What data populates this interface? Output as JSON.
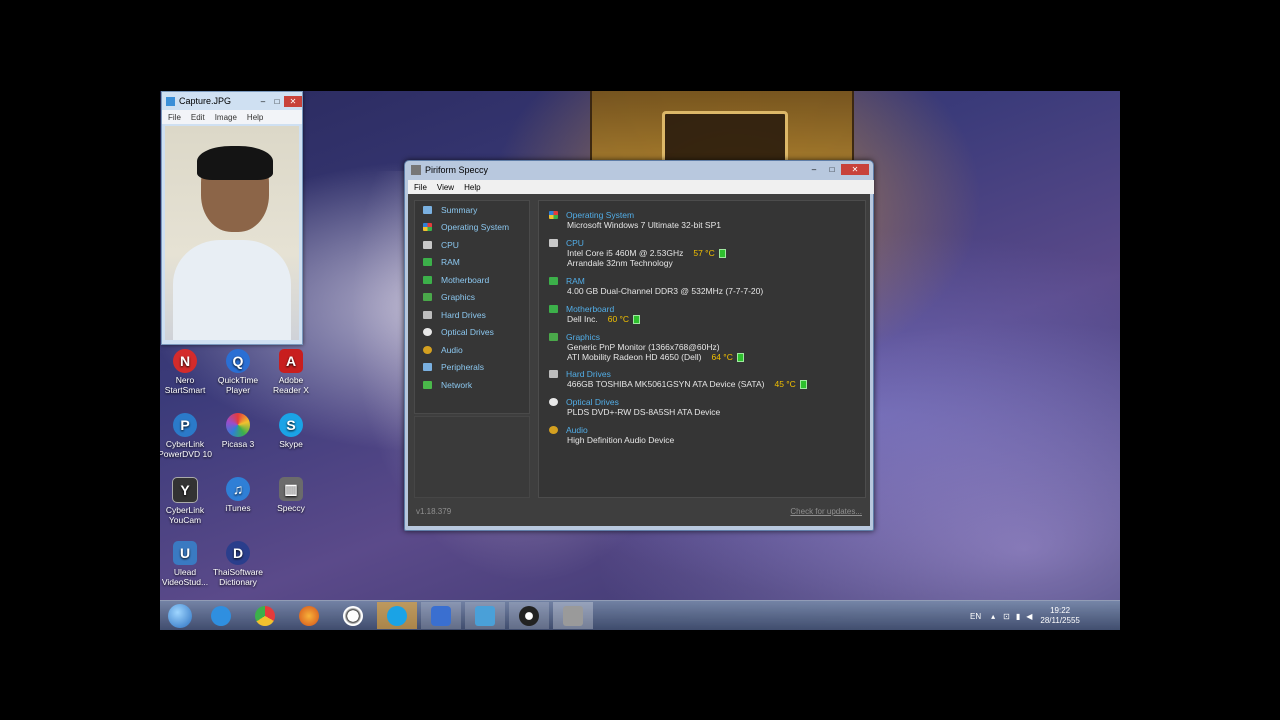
{
  "colors": {
    "accent_text": "#52aee8",
    "temp": "#f2c000",
    "sidebar_text": "#8cc8f0",
    "panel_bg": "#353535"
  },
  "capture_window": {
    "title": "Capture.JPG",
    "menu": [
      "File",
      "Edit",
      "Image",
      "Help"
    ]
  },
  "desktop_icons": [
    {
      "name": "Nero StartSmart",
      "line1": "Nero",
      "line2": "StartSmart",
      "icon": "nero-icon",
      "color": "#d42b2b"
    },
    {
      "name": "QuickTime Player",
      "line1": "QuickTime",
      "line2": "Player",
      "icon": "quicktime-icon",
      "color": "#2a6fd4"
    },
    {
      "name": "Adobe Reader X",
      "line1": "Adobe",
      "line2": "Reader X",
      "icon": "adobe-reader-icon",
      "color": "#c81e1e"
    },
    {
      "name": "CyberLink PowerDVD 10",
      "line1": "CyberLink",
      "line2": "PowerDVD 10",
      "icon": "powerdvd-icon",
      "color": "#2b7ac9"
    },
    {
      "name": "Picasa 3",
      "line1": "Picasa 3",
      "line2": "",
      "icon": "picasa-icon",
      "color": "#9c4ccc"
    },
    {
      "name": "Skype",
      "line1": "Skype",
      "line2": "",
      "icon": "skype-icon",
      "color": "#1aa3e6"
    },
    {
      "name": "CyberLink YouCam",
      "line1": "CyberLink",
      "line2": "YouCam",
      "icon": "youcam-icon",
      "color": "#333333"
    },
    {
      "name": "iTunes",
      "line1": "iTunes",
      "line2": "",
      "icon": "itunes-icon",
      "color": "#2f7fd6"
    },
    {
      "name": "Speccy",
      "line1": "Speccy",
      "line2": "",
      "icon": "speccy-icon",
      "color": "#6b6b6b"
    },
    {
      "name": "Ulead VideoStudio",
      "line1": "Ulead",
      "line2": "VideoStud...",
      "icon": "ulead-icon",
      "color": "#3a7ac2"
    },
    {
      "name": "ThaiSoftware Dictionary",
      "line1": "ThaiSoftware",
      "line2": "Dictionary",
      "icon": "dictionary-icon",
      "color": "#2a3e8c"
    }
  ],
  "speccy": {
    "title": "Piriform Speccy",
    "menu": [
      "File",
      "View",
      "Help"
    ],
    "sidebar": [
      {
        "label": "Summary",
        "icon": "summary-icon",
        "color": "#7ab0e0"
      },
      {
        "label": "Operating System",
        "icon": "windows-icon",
        "color": "#e0a030"
      },
      {
        "label": "CPU",
        "icon": "cpu-icon",
        "color": "#c8c8c8"
      },
      {
        "label": "RAM",
        "icon": "ram-icon",
        "color": "#3cb04a"
      },
      {
        "label": "Motherboard",
        "icon": "motherboard-icon",
        "color": "#3cb04a"
      },
      {
        "label": "Graphics",
        "icon": "graphics-icon",
        "color": "#4aa84a"
      },
      {
        "label": "Hard Drives",
        "icon": "harddrive-icon",
        "color": "#bdbdbd"
      },
      {
        "label": "Optical Drives",
        "icon": "optical-drive-icon",
        "color": "#e8e8e8"
      },
      {
        "label": "Audio",
        "icon": "audio-icon",
        "color": "#d4a020"
      },
      {
        "label": "Peripherals",
        "icon": "peripherals-icon",
        "color": "#7ab0e0"
      },
      {
        "label": "Network",
        "icon": "network-icon",
        "color": "#4ab84a"
      }
    ],
    "summary": {
      "os": {
        "heading": "Operating System",
        "line": "Microsoft Windows 7 Ultimate 32-bit SP1"
      },
      "cpu": {
        "heading": "CPU",
        "line1": "Intel Core i5 460M @ 2.53GHz",
        "temp": "57 °C",
        "line2": "Arrandale 32nm Technology"
      },
      "ram": {
        "heading": "RAM",
        "line": "4.00 GB Dual-Channel DDR3 @ 532MHz (7-7-7-20)"
      },
      "motherboard": {
        "heading": "Motherboard",
        "line": "Dell Inc.",
        "temp": "60 °C"
      },
      "graphics": {
        "heading": "Graphics",
        "line1": "Generic PnP Monitor (1366x768@60Hz)",
        "line2": "ATI Mobility Radeon HD 4650 (Dell)",
        "temp": "64 °C"
      },
      "hdd": {
        "heading": "Hard Drives",
        "line": "466GB TOSHIBA MK5061GSYN ATA Device (SATA)",
        "temp": "45 °C"
      },
      "optical": {
        "heading": "Optical Drives",
        "line": "PLDS DVD+-RW DS-8A5SH ATA Device"
      },
      "audio": {
        "heading": "Audio",
        "line": "High Definition Audio Device"
      }
    },
    "version": "v1.18.379",
    "check_updates": "Check for updates..."
  },
  "taskbar": {
    "pinned": [
      {
        "icon": "start-orb-icon",
        "color": "#3b8fd8"
      },
      {
        "icon": "internet-explorer-icon",
        "color": "#2f8fe0"
      },
      {
        "icon": "chrome-icon",
        "color": "#e0c020"
      },
      {
        "icon": "firefox-icon",
        "color": "#e06a18"
      },
      {
        "icon": "soccer-icon",
        "color": "#e8e8e8"
      },
      {
        "icon": "skype-icon",
        "color": "#1aa3e6"
      },
      {
        "icon": "messenger-icon",
        "color": "#3a6fd0"
      },
      {
        "icon": "capture-viewer-icon",
        "color": "#4aa0d8"
      },
      {
        "icon": "webcam-icon",
        "color": "#222222"
      },
      {
        "icon": "speccy-icon",
        "color": "#9a9a9a"
      }
    ],
    "language": "EN",
    "time": "19:22",
    "date": "28/11/2555"
  }
}
